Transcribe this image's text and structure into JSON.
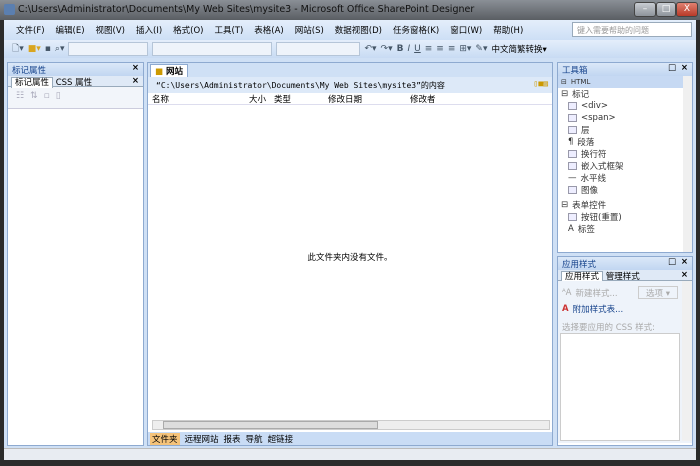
{
  "window": {
    "title": "C:\\Users\\Administrator\\Documents\\My Web Sites\\mysite3 - Microsoft Office SharePoint Designer",
    "min": "–",
    "max": "□",
    "close": "X"
  },
  "menu": [
    "文件(F)",
    "编辑(E)",
    "视图(V)",
    "插入(I)",
    "格式(O)",
    "工具(T)",
    "表格(A)",
    "网站(S)",
    "数据视图(D)",
    "任务窗格(K)",
    "窗口(W)",
    "帮助(H)"
  ],
  "help_placeholder": "键入需要帮助的问题",
  "toolbar": {
    "bold": "B",
    "italic": "I",
    "underline": "U",
    "convert": "中文简繁转换▾"
  },
  "left": {
    "title": "标记属性",
    "tabs": [
      "标记属性",
      "CSS 属性"
    ]
  },
  "center": {
    "tab": "网站",
    "path": "“C:\\Users\\Administrator\\Documents\\My Web Sites\\mysite3”的内容",
    "columns": [
      "名称",
      "大小",
      "类型",
      "修改日期",
      "修改者"
    ],
    "empty": "此文件夹内没有文件。",
    "bottom_tabs": [
      "文件夹",
      "远程网站",
      "报表",
      "导航",
      "超链接"
    ]
  },
  "toolbox": {
    "title": "工具箱",
    "sections": [
      {
        "label": "HTML"
      },
      {
        "label": "标记",
        "items": [
          "<div>",
          "<span>",
          "层",
          "段落",
          "换行符",
          "嵌入式框架",
          "水平线",
          "图像"
        ]
      },
      {
        "label": "表单控件",
        "items": [
          "按钮(重置)",
          "标签"
        ]
      }
    ]
  },
  "styles": {
    "title": "应用样式",
    "tabs": [
      "应用样式",
      "管理样式"
    ],
    "new_style": "新建样式...",
    "options": "选项 ▾",
    "attach": "附加样式表...",
    "select_label": "选择要应用的 CSS 样式:"
  }
}
